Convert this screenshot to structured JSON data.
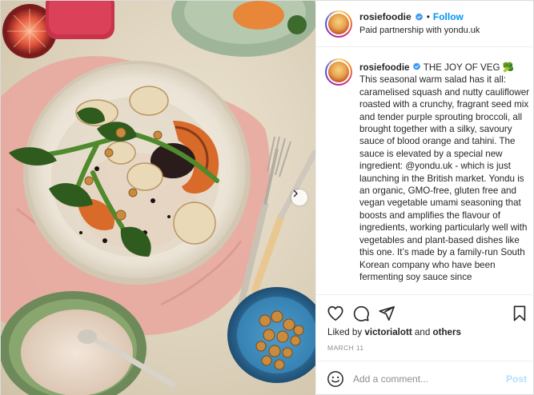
{
  "post": {
    "author": {
      "username": "rosiefoodie",
      "verified": true,
      "avatar": "avatar-image"
    },
    "header": {
      "separator": "•",
      "follow_label": "Follow",
      "partnership": "Paid partnership with yondu.uk"
    },
    "caption": {
      "username": "rosiefoodie",
      "body_before_mention": "THE JOY OF VEG 🥦 This seasonal warm salad has it all: caramelised squash and nutty cauliflower roasted with a crunchy, fragrant seed mix and tender purple sprouting broccoli, all brought together with a silky, savoury sauce of blood orange and tahini. The sauce is elevated by a special new ingredient: ",
      "mention": "@yondu.uk",
      "body_after_mention": " - which is just launching in the British market. Yondu is an organic, GMO-free, gluten free and vegan vegetable umami seasoning that boosts and amplifies the flavour of ingredients, working particularly well with vegetables and plant-based dishes like this one. It’s made by a family-run South Korean company who have been fermenting soy sauce since"
    },
    "actions": {
      "like_icon": "heart-icon",
      "comment_icon": "comment-bubble-icon",
      "share_icon": "paper-plane-icon",
      "save_icon": "bookmark-icon"
    },
    "likes": {
      "prefix": "Liked by",
      "user": "victorialott",
      "connector": "and",
      "others": "others"
    },
    "date": "MARCH 11",
    "comment": {
      "placeholder": "Add a comment...",
      "post_label": "Post",
      "emoji_icon": "smiley-icon"
    },
    "media": {
      "carousel_next_icon": "chevron-right-icon"
    },
    "colors": {
      "link_blue": "#0095f6",
      "post_disabled": "#b2dffc",
      "text": "#262626",
      "muted": "#8e8e8e"
    }
  }
}
